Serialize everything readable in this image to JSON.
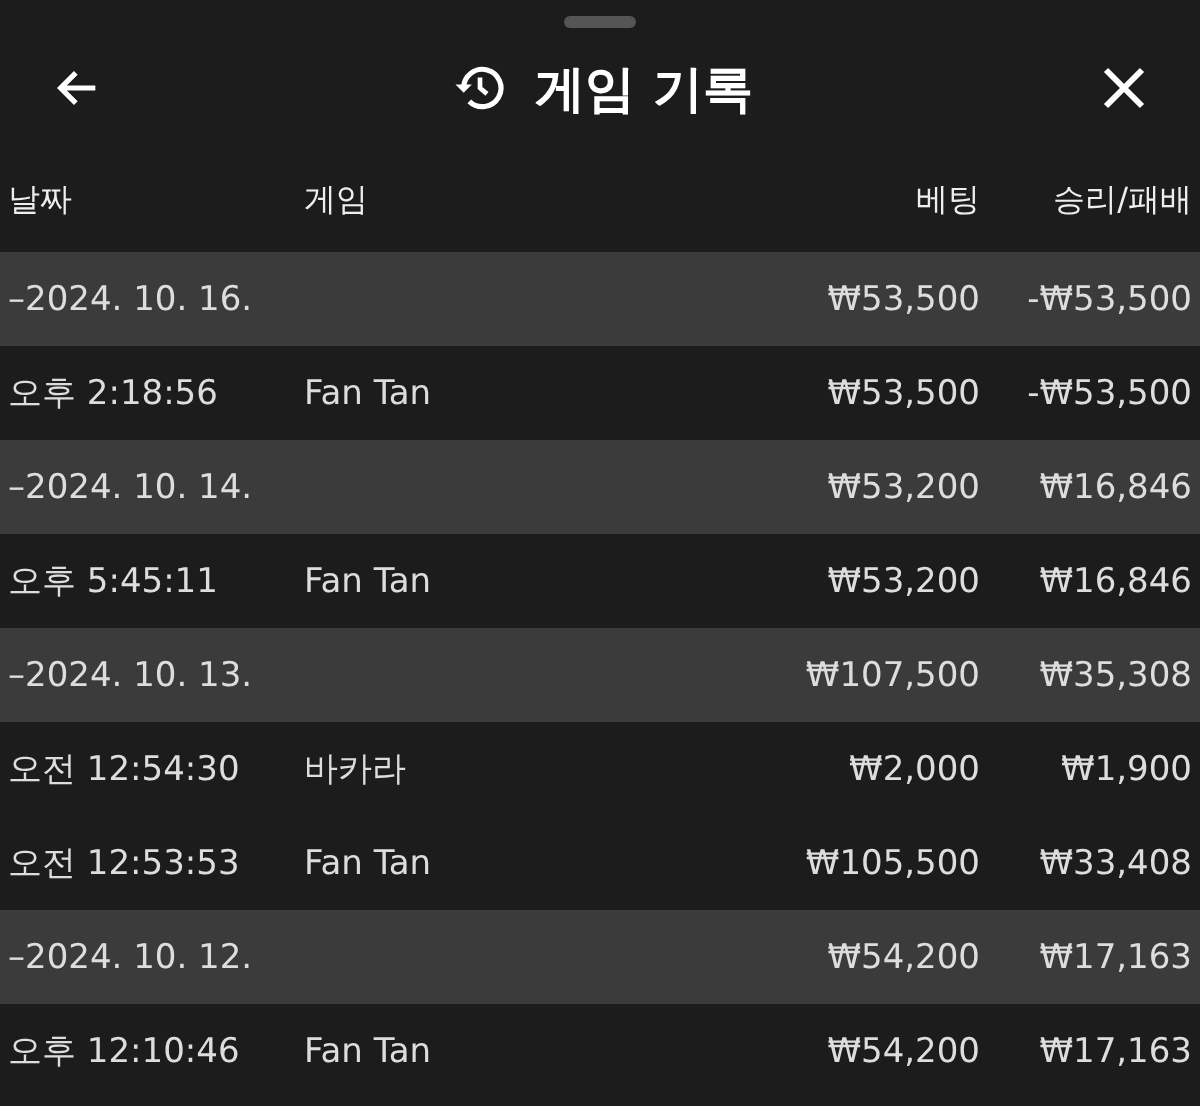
{
  "header": {
    "title": "게임 기록"
  },
  "columns": [
    "날짜",
    "게임",
    "베팅",
    "승리/패배"
  ],
  "rows": [
    {
      "kind": "group",
      "date": "–2024. 10. 16.",
      "bet": "₩53,500",
      "result": "-₩53,500"
    },
    {
      "kind": "game",
      "date": "오후 2:18:56",
      "game": "Fan Tan",
      "bet": "₩53,500",
      "result": "-₩53,500"
    },
    {
      "kind": "group",
      "date": "–2024. 10. 14.",
      "bet": "₩53,200",
      "result": "₩16,846"
    },
    {
      "kind": "game",
      "date": "오후 5:45:11",
      "game": "Fan Tan",
      "bet": "₩53,200",
      "result": "₩16,846"
    },
    {
      "kind": "group",
      "date": "–2024. 10. 13.",
      "bet": "₩107,500",
      "result": "₩35,308"
    },
    {
      "kind": "game",
      "date": "오전 12:54:30",
      "game": "바카라",
      "bet": "₩2,000",
      "result": "₩1,900"
    },
    {
      "kind": "game",
      "date": "오전 12:53:53",
      "game": "Fan Tan",
      "bet": "₩105,500",
      "result": "₩33,408"
    },
    {
      "kind": "group",
      "date": "–2024. 10. 12.",
      "bet": "₩54,200",
      "result": "₩17,163"
    },
    {
      "kind": "game",
      "date": "오후 12:10:46",
      "game": "Fan Tan",
      "bet": "₩54,200",
      "result": "₩17,163"
    }
  ]
}
